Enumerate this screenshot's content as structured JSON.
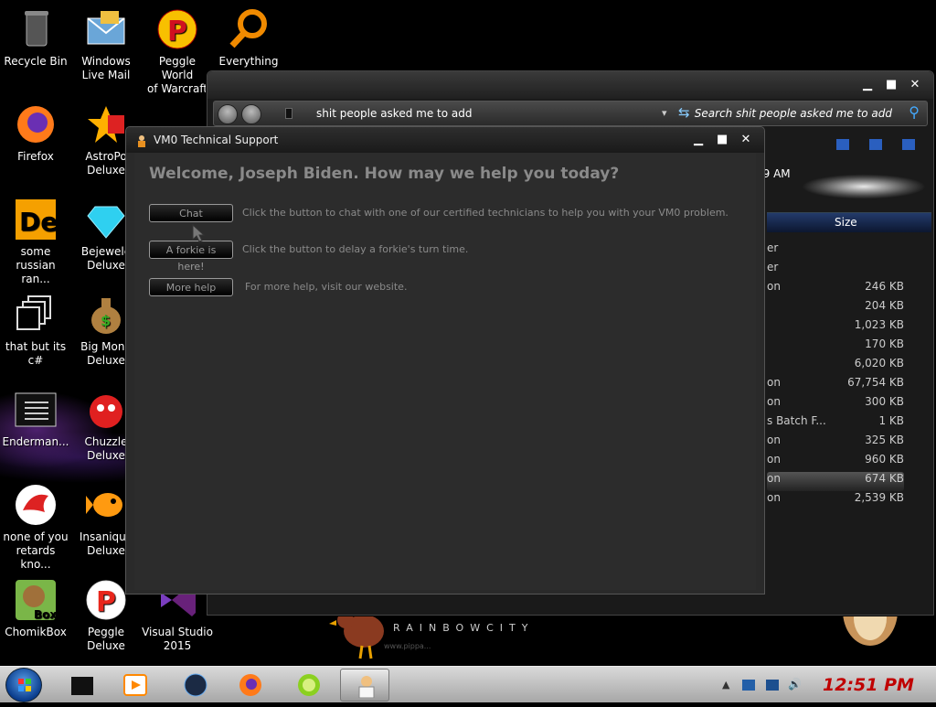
{
  "desktop": {
    "icons": [
      {
        "label": "Recycle Bin",
        "name": "recycle-bin-icon"
      },
      {
        "label": "Windows\nLive Mail",
        "name": "windows-live-mail-icon"
      },
      {
        "label": "Peggle World\nof Warcraft",
        "name": "peggle-icon"
      },
      {
        "label": "Everything",
        "name": "search-everything-icon"
      },
      {
        "label": "Firefox",
        "name": "firefox-icon"
      },
      {
        "label": "AstroPo\nDeluxe",
        "name": "astropop-icon"
      },
      {
        "label": "some\nrussian ran...",
        "name": "de-app-icon"
      },
      {
        "label": "Bejewele\nDeluxe",
        "name": "diamond-icon"
      },
      {
        "label": "that but its c#",
        "name": "stacked-windows-icon"
      },
      {
        "label": "Big Mone\nDeluxe",
        "name": "money-bag-icon"
      },
      {
        "label": "Enderman...",
        "name": "console-icon"
      },
      {
        "label": "Chuzzle\nDeluxe",
        "name": "chuzzle-icon"
      },
      {
        "label": "none of you\nretards kno...",
        "name": "dragon-icon"
      },
      {
        "label": "Insaniqua\nDeluxe",
        "name": "fish-icon"
      },
      {
        "label": "ChomikBox",
        "name": "hamster-box-icon"
      },
      {
        "label": "Peggle\nDeluxe",
        "name": "peggle-deluxe-icon"
      },
      {
        "label": "Visual Studio\n2015",
        "name": "visual-studio-icon"
      }
    ],
    "wallpaper_text": "RAINBOWCITY",
    "wallpaper_subtext": "www.pippa..."
  },
  "explorer": {
    "address": "shit people asked me to add",
    "search_placeholder": "Search shit people asked me to add",
    "time_fragment": "09 AM",
    "size_header": "Size",
    "rows": [
      {
        "type": "er",
        "size": ""
      },
      {
        "type": "er",
        "size": ""
      },
      {
        "type": "on",
        "size": "246 KB"
      },
      {
        "type": "",
        "size": "204 KB"
      },
      {
        "type": "",
        "size": "1,023 KB"
      },
      {
        "type": "",
        "size": "170 KB"
      },
      {
        "type": "",
        "size": "6,020 KB"
      },
      {
        "type": "on",
        "size": "67,754 KB"
      },
      {
        "type": "on",
        "size": "300 KB"
      },
      {
        "type": "s Batch F...",
        "size": "1 KB"
      },
      {
        "type": "on",
        "size": "325 KB"
      },
      {
        "type": "on",
        "size": "960 KB"
      },
      {
        "type": "on",
        "size": "674 KB"
      },
      {
        "type": "on",
        "size": "2,539 KB"
      }
    ]
  },
  "support": {
    "title": "VM0 Technical Support",
    "welcome": "Welcome, Joseph Biden. How may we help you today?",
    "buttons": [
      {
        "label": "Chat",
        "desc": "Click the button to chat with one of our certified technicians to help you with your VM0 problem."
      },
      {
        "label": "A forkie is here!",
        "desc": "Click the button to delay a forkie's turn time."
      },
      {
        "label": "More help",
        "desc": "For more help, visit our website."
      }
    ]
  },
  "taskbar": {
    "clock": "12:51 PM"
  },
  "colors": {
    "clock": "#c00000",
    "taskbar": "#bdbdbd"
  }
}
